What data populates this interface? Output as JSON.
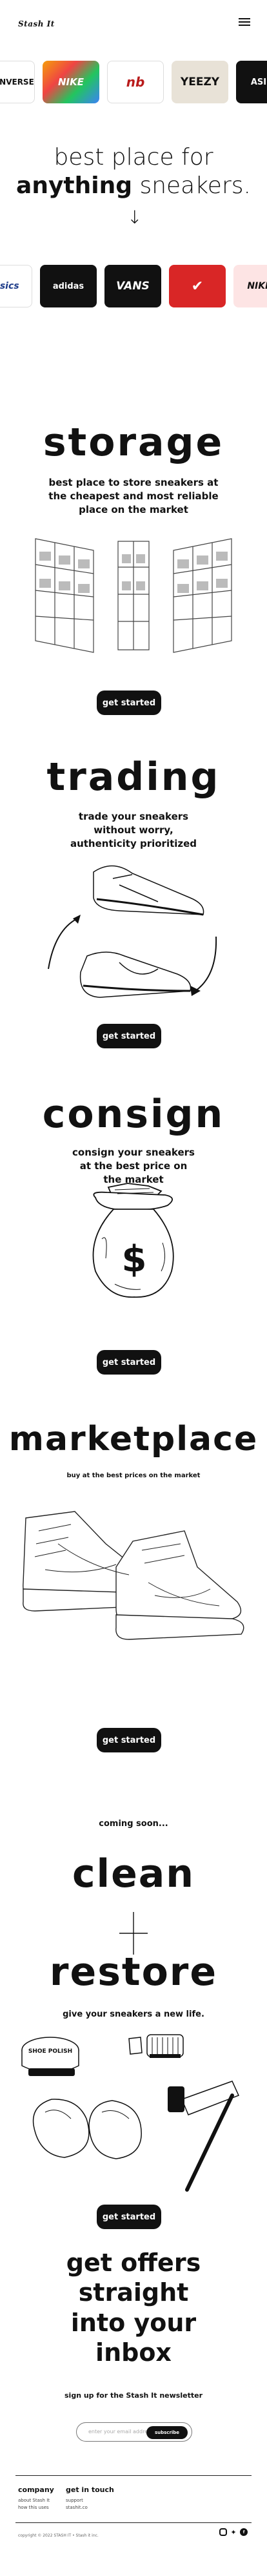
{
  "header": {
    "logo": "Stash It",
    "menu_label": "menu"
  },
  "brands_top": [
    {
      "label": "★ CONVERSE",
      "bg": "#ffffff",
      "fg": "#111111"
    },
    {
      "label": "NIKE",
      "bg": "#ffffff",
      "fg": "#ffffff"
    },
    {
      "label": "nb",
      "bg": "#ffffff",
      "fg": "#b91c1c"
    },
    {
      "label": "YEEZY",
      "bg": "#e8e2d7",
      "fg": "#111111"
    },
    {
      "label": "ASI",
      "bg": "#111111",
      "fg": "#ffffff"
    }
  ],
  "hero": {
    "title_top": "best place for",
    "title_bold": "anything",
    "title_rest": "sneakers.",
    "arrow": "↓"
  },
  "brands_bottom": [
    {
      "label": "asics",
      "bg": "#ffffff",
      "fg": "#1f3d8a"
    },
    {
      "label": "adidas",
      "bg": "#111111",
      "fg": "#ffffff"
    },
    {
      "label": "VANS",
      "bg": "#111111",
      "fg": "#ffffff"
    },
    {
      "label": "✔",
      "bg": "#d92626",
      "fg": "#ffffff"
    },
    {
      "label": "NIKE",
      "bg": "#fde4e4",
      "fg": "#111111"
    }
  ],
  "sections": {
    "storage": {
      "title": "storage",
      "subtitle": "best place to store sneakers at the cheapest and most reliable place on the market",
      "button": "get started"
    },
    "trading": {
      "title": "trading",
      "subtitle": "trade your sneakers without worry, authenticity prioritized",
      "button": "get started"
    },
    "consign": {
      "title": "consign",
      "subtitle": "consign your sneakers at the best price on the market",
      "button": "get started"
    },
    "marketplace": {
      "title": "marketplace",
      "subtitle": "buy at the best prices on the market",
      "button": "get started"
    },
    "restore": {
      "coming_soon": "coming soon...",
      "word_clean": "clean",
      "word_restore": "restore",
      "subtitle": "give your sneakers a new life.",
      "button": "get started",
      "polish_lid": "SHOE POLISH"
    }
  },
  "newsletter": {
    "title_lines": [
      "get offers",
      "straight",
      "into your",
      "inbox"
    ],
    "subtitle": "sign up for the Stash It newsletter",
    "email_placeholder": "enter your email address",
    "subscribe": "subscribe"
  },
  "footer": {
    "company": {
      "heading": "company",
      "links": [
        "about Stash It",
        "how this uses"
      ]
    },
    "contact": {
      "heading": "get in touch",
      "links": [
        "support",
        "stashit.co"
      ]
    },
    "social_icons": [
      "instagram-icon",
      "twitter-icon",
      "facebook-icon"
    ],
    "copyright": "copyright © 2022 STASH IT • Stash it inc."
  },
  "colors": {
    "accent": "#111111",
    "background": "#ffffff",
    "nike_red": "#d92626",
    "newbalance_red": "#b91c1c"
  }
}
